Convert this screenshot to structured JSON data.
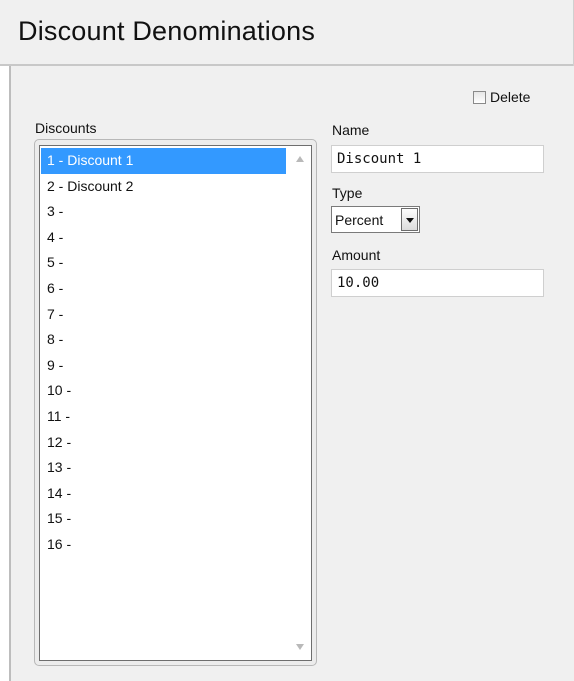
{
  "header": {
    "title": "Discount Denominations"
  },
  "delete": {
    "label": "Delete",
    "checked": false
  },
  "discounts": {
    "label": "Discounts",
    "items": [
      "1 - Discount 1",
      "2 - Discount 2",
      "3 -",
      "4 -",
      "5 -",
      "6 -",
      "7 -",
      "8 -",
      "9 -",
      "10 -",
      "11 -",
      "12 -",
      "13 -",
      "14 -",
      "15 -",
      "16 -"
    ],
    "selected_index": 0
  },
  "form": {
    "name_label": "Name",
    "name_value": "Discount 1",
    "type_label": "Type",
    "type_value": "Percent",
    "amount_label": "Amount",
    "amount_value": "10.00"
  },
  "colors": {
    "selection": "#3399ff",
    "panel_bg": "#f0f0f0"
  }
}
